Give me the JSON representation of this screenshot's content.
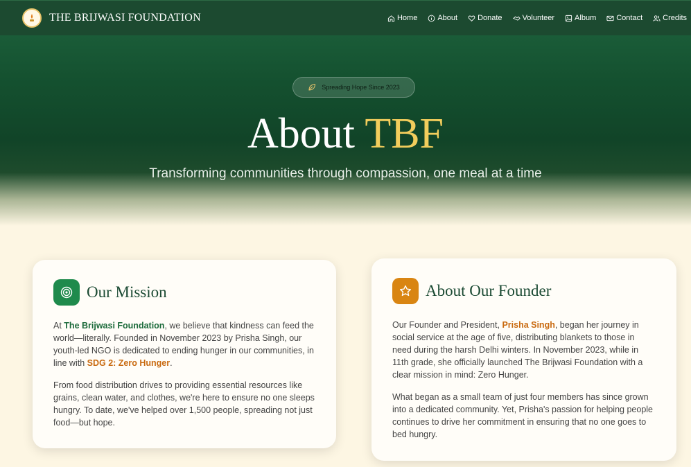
{
  "nav": {
    "brand": "THE BRIJWASI FOUNDATION",
    "links": [
      {
        "label": "Home",
        "icon": "home-icon"
      },
      {
        "label": "About",
        "icon": "info-icon"
      },
      {
        "label": "Donate",
        "icon": "heart-icon"
      },
      {
        "label": "Volunteer",
        "icon": "handshake-icon"
      },
      {
        "label": "Album",
        "icon": "image-icon"
      },
      {
        "label": "Contact",
        "icon": "mail-icon"
      },
      {
        "label": "Credits",
        "icon": "users-icon"
      }
    ]
  },
  "hero": {
    "badge": "Spreading Hope Since 2023",
    "title_main": "About ",
    "title_accent": "TBF",
    "subtitle": "Transforming communities through compassion, one meal at a time"
  },
  "mission": {
    "title": "Our Mission",
    "p1_a": "At ",
    "p1_org": "The Brijwasi Foundation",
    "p1_b": ", we believe that kindness can feed the world—literally. Founded in November 2023 by Prisha Singh, our youth-led NGO is dedicated to ending hunger in our communities, in line with ",
    "p1_sdg": "SDG 2: Zero Hunger",
    "p1_c": ".",
    "p2": "From food distribution drives to providing essential resources like grains, clean water, and clothes, we're here to ensure no one sleeps hungry. To date, we've helped over 1,500 people, spreading not just food—but hope."
  },
  "founder": {
    "title": "About Our Founder",
    "p1_a": "Our Founder and President, ",
    "p1_name": "Prisha Singh",
    "p1_b": ", began her journey in social service at the age of five, distributing blankets to those in need during the harsh Delhi winters. In November 2023, while in 11th grade, she officially launched The Brijwasi Foundation with a clear mission in mind: Zero Hunger.",
    "p2": "What began as a small team of just four members has since grown into a dedicated community. Yet, Prisha's passion for helping people continues to drive her commitment in ensuring that no one goes to bed hungry."
  },
  "colors": {
    "nav_bg": "#1c4a30",
    "accent_gold": "#f2cd5c",
    "green": "#1f8a4c",
    "orange": "#d98512",
    "background": "#fdf6e3"
  }
}
